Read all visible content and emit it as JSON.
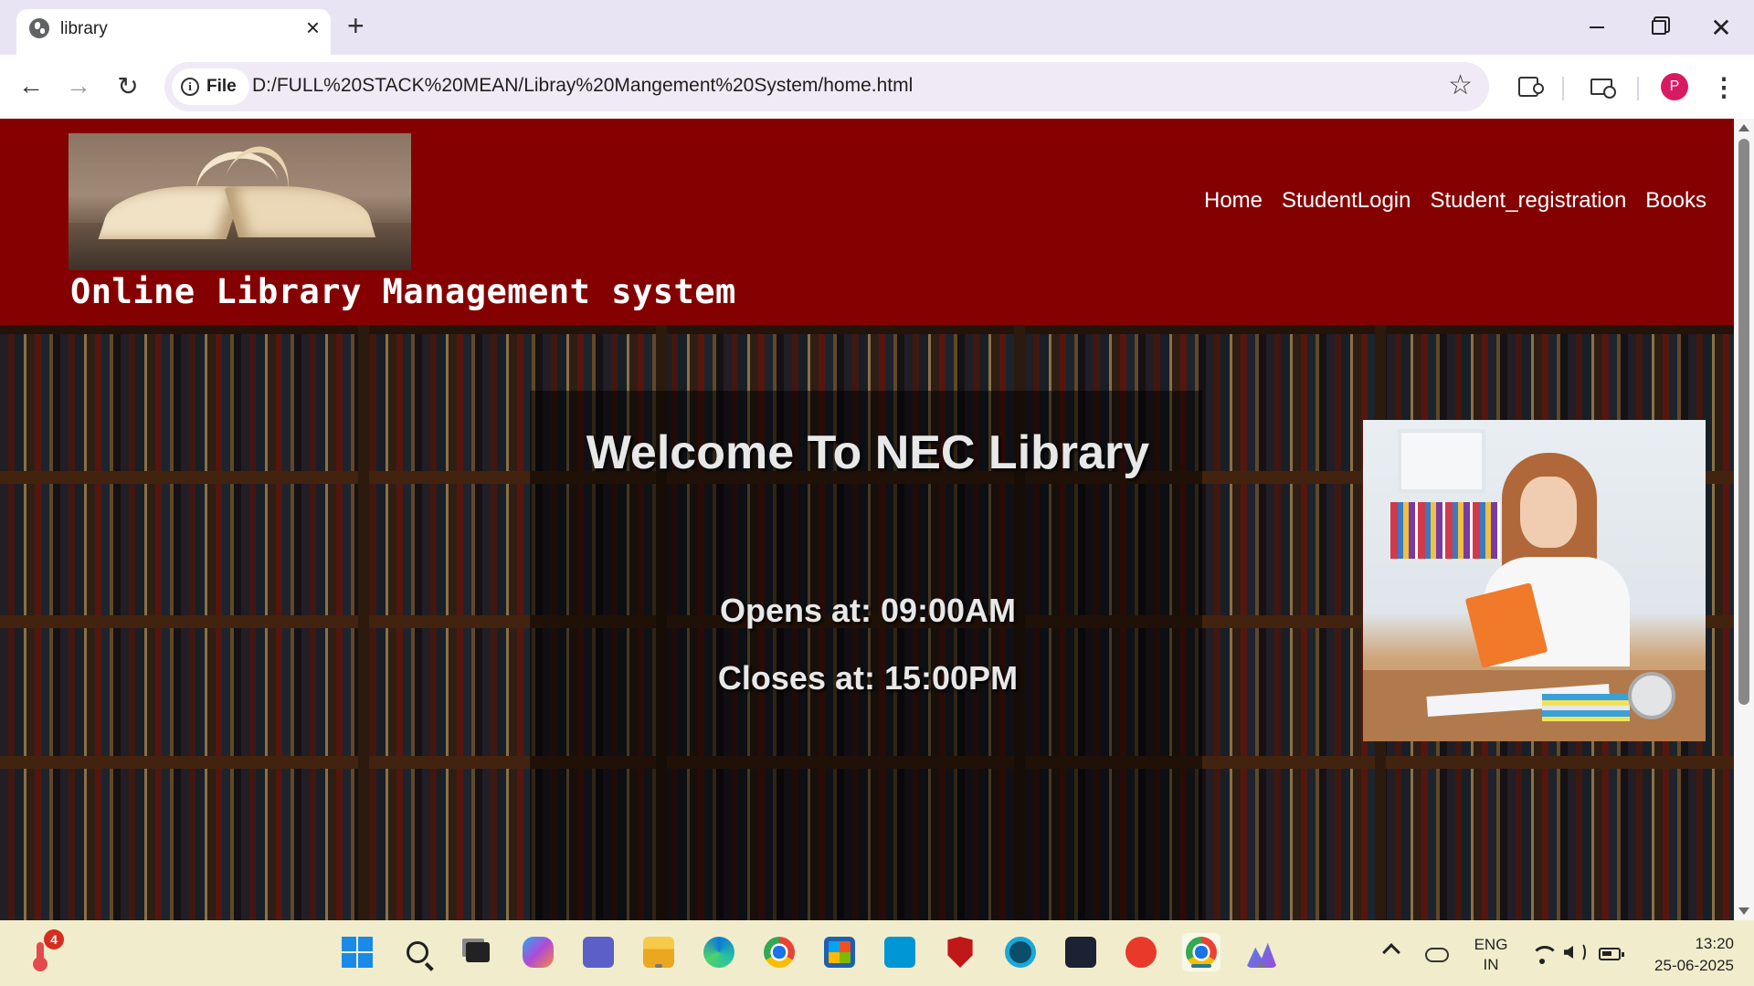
{
  "browser": {
    "tab_title": "library",
    "new_tab_label": "+",
    "url_scheme_chip": "File",
    "url": "D:/FULL%20STACK%20MEAN/Libray%20Mangement%20System/home.html",
    "profile_initial": "P"
  },
  "site": {
    "header_bg": "#850000",
    "title": "Online Library Management system",
    "nav": [
      "Home",
      "StudentLogin",
      "Student_registration",
      "Books"
    ],
    "logo_image": "open-book-photo",
    "side_image": "student-reading-photo"
  },
  "hero": {
    "welcome": "Welcome To NEC Library",
    "opens": "Opens at: 09:00AM",
    "closes": "Closes at: 15:00PM",
    "background": "bookshelf-photo"
  },
  "taskbar": {
    "notification_count": "4",
    "apps": [
      "start",
      "search",
      "task-view",
      "copilot",
      "teams",
      "file-explorer",
      "edge",
      "chrome",
      "microsoft-store",
      "myhp",
      "mcafee",
      "alexa",
      "dolby",
      "wps-office",
      "chrome-profile",
      "photos"
    ],
    "lang_line1": "ENG",
    "lang_line2": "IN",
    "time": "13:20",
    "date": "25-06-2025"
  }
}
